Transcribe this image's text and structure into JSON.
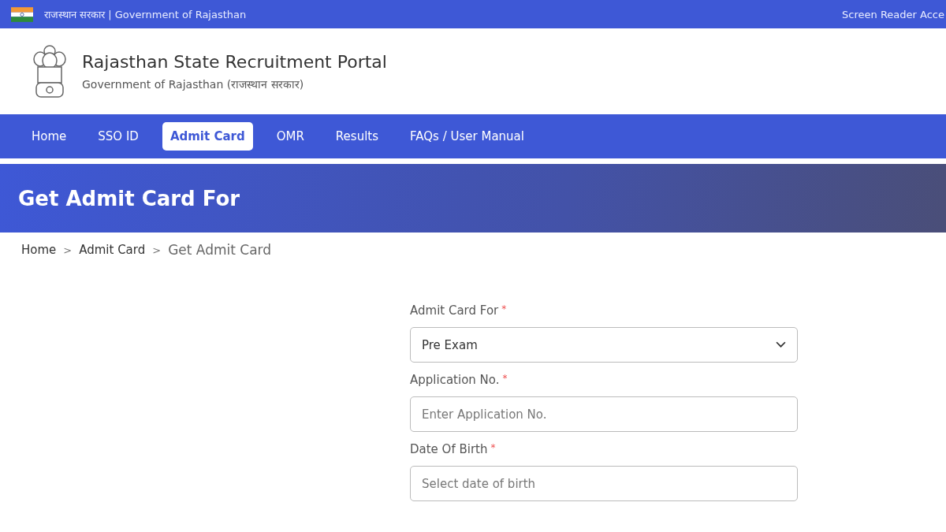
{
  "top_bar": {
    "title": "राजस्थान सरकार | Government of Rajasthan",
    "link": "Screen Reader Acce"
  },
  "header": {
    "title": "Rajasthan State Recruitment Portal",
    "subtitle": "Government of Rajasthan (राजस्थान सरकार)"
  },
  "nav": [
    {
      "label": "Home",
      "selected": false
    },
    {
      "label": "SSO ID",
      "selected": false
    },
    {
      "label": "Admit Card",
      "selected": true
    },
    {
      "label": "OMR",
      "selected": false
    },
    {
      "label": "Results",
      "selected": false
    },
    {
      "label": "FAQs / User Manual",
      "selected": false
    }
  ],
  "banner": {
    "title": "Get Admit Card For"
  },
  "breadcrumb": {
    "separator": ">",
    "items": [
      {
        "label": "Home",
        "current": false
      },
      {
        "label": "Admit Card",
        "current": false
      },
      {
        "label": "Get Admit Card",
        "current": true
      }
    ]
  },
  "form": {
    "fields": [
      {
        "kind": "select",
        "label": "Admit Card For",
        "required_mark": "*",
        "value": "Pre Exam"
      },
      {
        "kind": "input",
        "label": "Application No.",
        "required_mark": "*",
        "placeholder": "Enter Application No."
      },
      {
        "kind": "input",
        "label": "Date Of Birth",
        "required_mark": "*",
        "placeholder": "Select date of birth"
      }
    ]
  }
}
